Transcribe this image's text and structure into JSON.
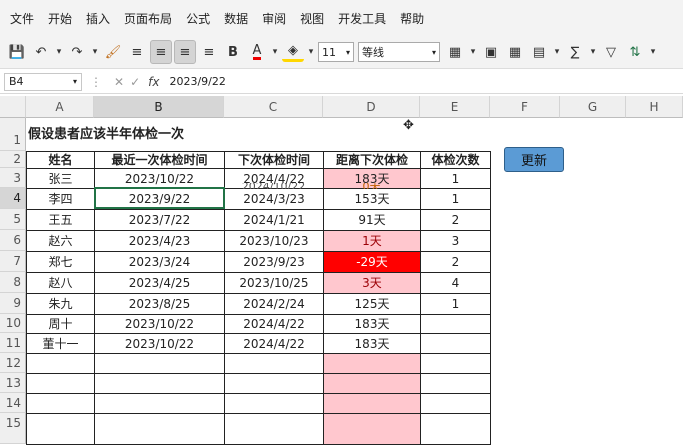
{
  "menu": [
    "文件",
    "开始",
    "插入",
    "页面布局",
    "公式",
    "数据",
    "审阅",
    "视图",
    "开发工具",
    "帮助"
  ],
  "toolbar": {
    "font_size": "11",
    "border_style": "等线",
    "bold_label": "B",
    "font_color_label": "A",
    "sum_label": "∑"
  },
  "formula_bar": {
    "name_box": "B4",
    "fx_label": "fx",
    "value": "2023/9/22"
  },
  "columns": [
    "A",
    "B",
    "C",
    "D",
    "E",
    "F",
    "G",
    "H"
  ],
  "rows": [
    "1",
    "2",
    "3",
    "4",
    "5",
    "6",
    "7",
    "8",
    "9",
    "10",
    "11",
    "12",
    "13",
    "14",
    "15"
  ],
  "sheet": {
    "title": "假设患者应该半年体检一次",
    "headers": [
      "姓名",
      "最近一次体检时间",
      "下次体检时间",
      "距离下次体检",
      "体检次数"
    ],
    "records": [
      {
        "name": "张三",
        "last": "2023/10/22",
        "next": "2024/4/22",
        "remain": "183天",
        "count": "1",
        "next2": "2024/10/22",
        "remain2": "0天"
      },
      {
        "name": "李四",
        "last": "2023/9/22",
        "next": "2024/3/23",
        "remain": "153天",
        "count": "1"
      },
      {
        "name": "王五",
        "last": "2023/7/22",
        "next": "2024/1/21",
        "remain": "91天",
        "count": "2"
      },
      {
        "name": "赵六",
        "last": "2023/4/23",
        "next": "2023/10/23",
        "remain": "1天",
        "count": "3"
      },
      {
        "name": "郑七",
        "last": "2023/3/24",
        "next": "2023/9/23",
        "remain": "-29天",
        "count": "2"
      },
      {
        "name": "赵八",
        "last": "2023/4/25",
        "next": "2023/10/25",
        "remain": "3天",
        "count": "4"
      },
      {
        "name": "朱九",
        "last": "2023/8/25",
        "next": "2024/2/24",
        "remain": "125天",
        "count": "1"
      },
      {
        "name": "周十",
        "last": "2023/10/22",
        "next": "2024/4/22",
        "remain": "183天",
        "count": ""
      },
      {
        "name": "董十一",
        "last": "2023/10/22",
        "next": "2024/4/22",
        "remain": "183天",
        "count": ""
      }
    ]
  },
  "update_button": "更新",
  "colors": {
    "accent": "#217346",
    "pink_fill": "#ffc7ce",
    "red_fill": "#ff0000",
    "button": "#5b9bd5"
  }
}
